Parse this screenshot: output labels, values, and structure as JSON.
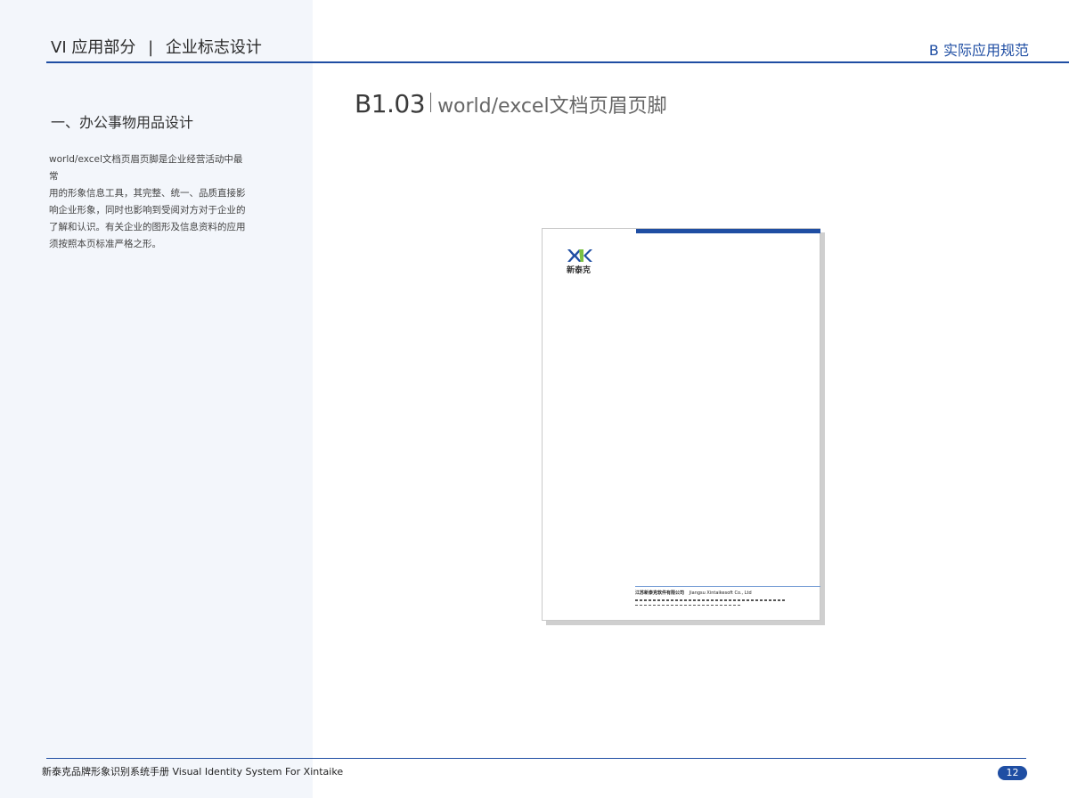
{
  "header": {
    "section": "VI 应用部分",
    "separator": "|",
    "subsection": "企业标志设计",
    "right_label": "B  实际应用规范"
  },
  "sidebar": {
    "title": "一、办公事物用品设计",
    "description": "world/excel文档页眉页脚是企业经营活动中最常\n用的形象信息工具，其完整、统一、品质直接影\n响企业形象，同时也影响到受阅对方对于企业的\n了解和认识。有关企业的图形及信息资料的应用\n须按照本页标准严格之形。"
  },
  "page": {
    "code": "B1.03",
    "title": "world/excel文档页眉页脚"
  },
  "mockup": {
    "logo_icon": "xtk-logo-icon",
    "logo_text": "新泰克",
    "company_cn": "江苏新泰克软件有限公司",
    "company_en": "Jiangsu Xintaikesoft Co., Ltd"
  },
  "footer": {
    "text": "新泰克品牌形象识别系统手册  Visual Identity System For Xintaike",
    "page_number": "12"
  },
  "colors": {
    "accent": "#1f4ea3",
    "panel": "#f3f6fb",
    "logo_green": "#7cc242"
  }
}
